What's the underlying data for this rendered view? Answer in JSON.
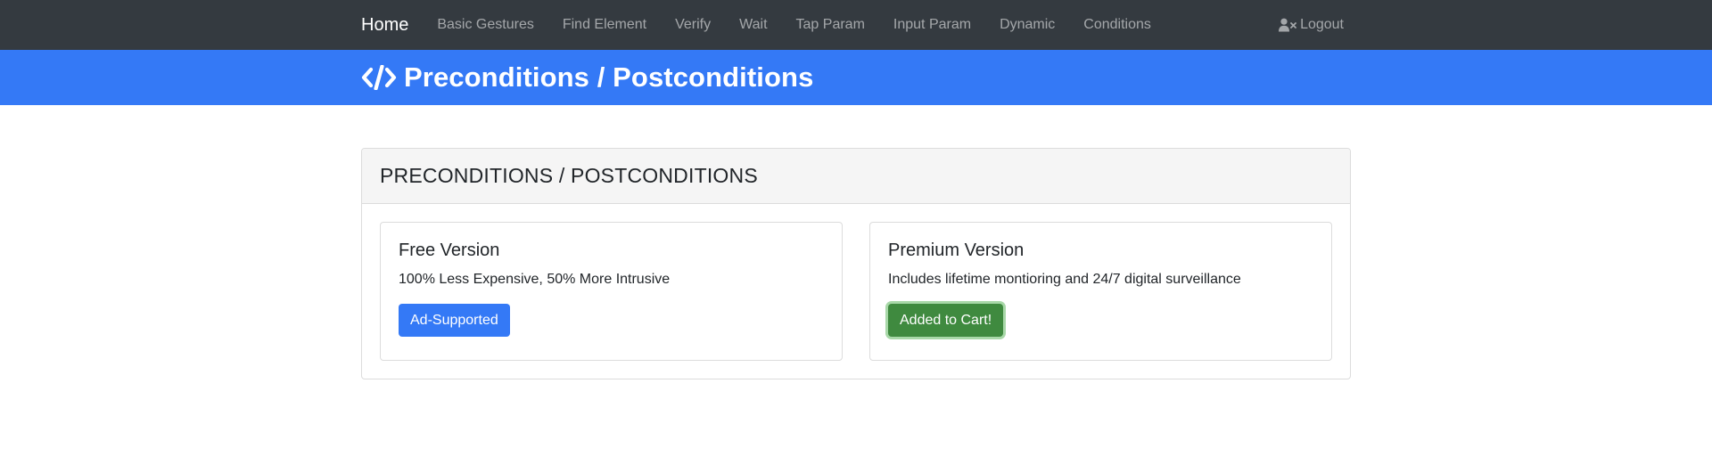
{
  "navbar": {
    "brand": "Home",
    "links": [
      "Basic Gestures",
      "Find Element",
      "Verify",
      "Wait",
      "Tap Param",
      "Input Param",
      "Dynamic",
      "Conditions"
    ],
    "logout_label": "Logout"
  },
  "banner": {
    "title": "Preconditions / Postconditions",
    "icon": "code-icon"
  },
  "card": {
    "header": "PRECONDITIONS / POSTCONDITIONS",
    "free": {
      "title": "Free Version",
      "description": "100% Less Expensive, 50% More Intrusive",
      "button": "Ad-Supported"
    },
    "premium": {
      "title": "Premium Version",
      "description": "Includes lifetime montioring and 24/7 digital surveillance",
      "button": "Added to Cart!"
    }
  },
  "colors": {
    "navbar_bg": "#343a40",
    "banner_bg": "#3479f6",
    "primary_button": "#3479f6",
    "success_button": "#3f8a3f"
  }
}
